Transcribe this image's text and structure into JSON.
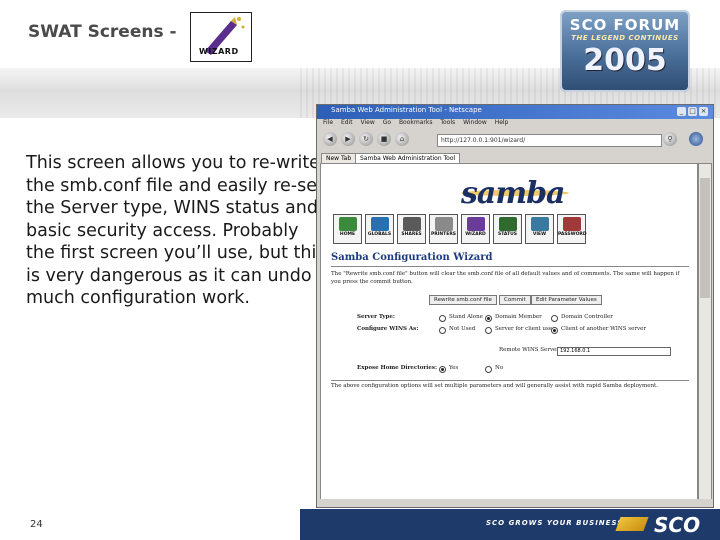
{
  "slide": {
    "title": "SWAT Screens -",
    "wizard_logo_text": "WIZARD",
    "body": "This screen allows you to re-write the smb.conf file and easily re-set the Server type, WINS status and basic security access. Probably the first screen you’ll use, but this is very dangerous as it can undo much configuration work.",
    "page_number": "24",
    "footer_tagline": "SCO GROWS YOUR BUSINESS",
    "footer_logo": "SCO"
  },
  "forum_badge": {
    "line1": "SCO FORUM",
    "line2": "THE LEGEND CONTINUES",
    "year": "2005"
  },
  "browser": {
    "window_title": "Samba Web Administration Tool - Netscape",
    "menu": [
      "File",
      "Edit",
      "View",
      "Go",
      "Bookmarks",
      "Tools",
      "Window",
      "Help"
    ],
    "url": "http://127.0.0.1:901/wizard/",
    "tabs": [
      "New Tab",
      "Samba Web Administration Tool"
    ]
  },
  "samba": {
    "logo": "samba",
    "toolbar": [
      "HOME",
      "GLOBALS",
      "SHARES",
      "PRINTERS",
      "WIZARD",
      "STATUS",
      "VIEW",
      "PASSWORD"
    ],
    "heading": "Samba Configuration Wizard",
    "description": "The \"Rewrite smb.conf file\" button will clear the smb.conf file of all default values and of comments. The same will happen if you press the commit button.",
    "buttons": [
      "Rewrite smb.conf file",
      "Commit",
      "Edit Parameter Values"
    ],
    "server_type_label": "Server Type:",
    "server_type_options": [
      "Stand Alone",
      "Domain Member",
      "Domain Controller"
    ],
    "wins_label": "Configure WINS As:",
    "wins_options": [
      "Not Used",
      "Server for client use",
      "Client of another WINS server"
    ],
    "wins_server_label": "Remote WINS Server",
    "wins_server_value": "192.168.0.1",
    "home_dirs_label": "Expose Home Directories:",
    "home_dirs_options": [
      "Yes",
      "No"
    ],
    "footer_note": "The above configuration options will set multiple parameters and will generally assist with rapid Samba deployment."
  }
}
